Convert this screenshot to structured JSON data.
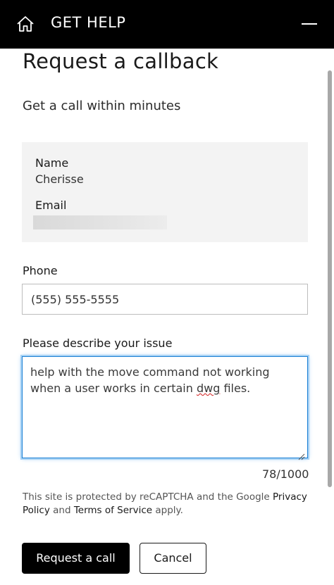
{
  "header": {
    "home_icon": "home-icon",
    "title": "GET HELP",
    "menu_icon": "minus-icon"
  },
  "main": {
    "title": "Request a callback",
    "subtitle": "Get a call within minutes",
    "contact": {
      "name_label": "Name",
      "name_value": "Cherisse",
      "email_label": "Email"
    },
    "phone": {
      "label": "Phone",
      "placeholder": "(555) 555-5555"
    },
    "issue": {
      "label": "Please describe your issue",
      "text_before": "help with the move command not working when a user works in certain ",
      "text_misspelled": "dwg",
      "text_after": " files.",
      "char_count": "78/1000"
    },
    "recaptcha": {
      "prefix": "This site is protected by reCAPTCHA and the Google ",
      "privacy_link": "Privacy Policy",
      "and_text": " and ",
      "terms_link": "Terms of Service",
      "suffix": " apply."
    },
    "buttons": {
      "submit": "Request a call",
      "cancel": "Cancel"
    }
  },
  "colors": {
    "header_bg": "#000000",
    "focus_border": "#1a7fd4",
    "info_bg": "#f3f3f3",
    "primary_button": "#000000"
  }
}
